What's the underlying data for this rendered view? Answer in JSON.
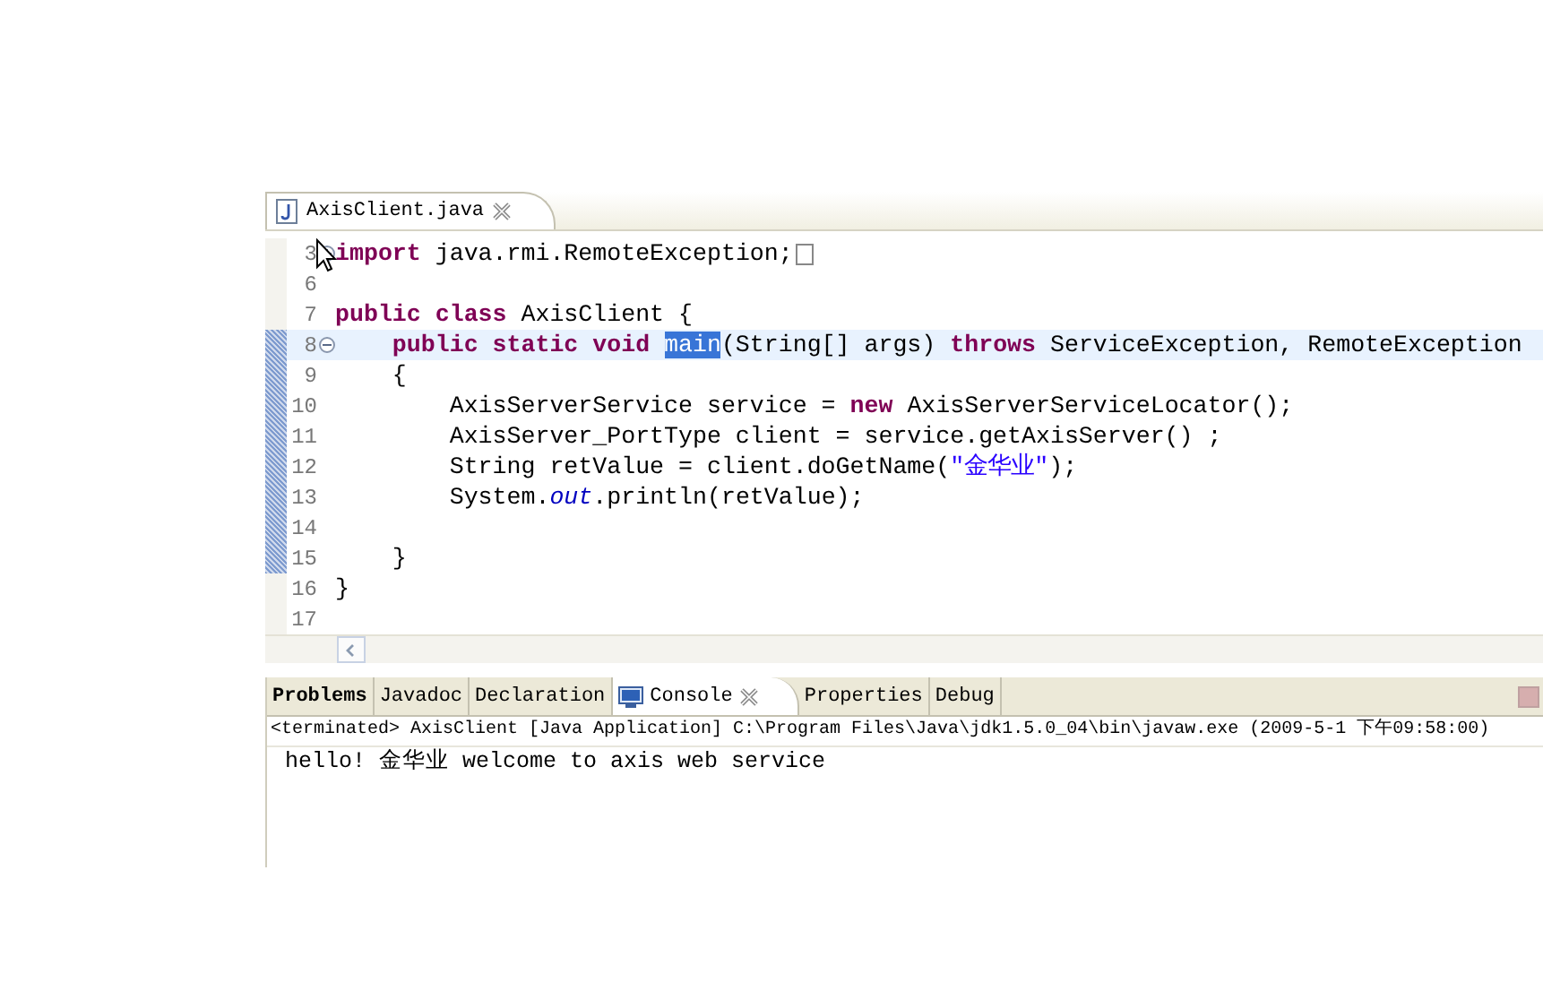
{
  "editor": {
    "tabs": [
      {
        "label": "AxisClient.java",
        "selected": true
      }
    ],
    "lines": [
      {
        "number": "3",
        "expanded": false,
        "marked": false,
        "current": false,
        "tokens": [
          {
            "kind": "keyword",
            "text": "import"
          },
          {
            "kind": "plain",
            "text": " java.rmi.RemoteException;"
          }
        ],
        "folded_box": true
      },
      {
        "number": "6",
        "marked": false,
        "current": false
      },
      {
        "number": "7",
        "marked": false,
        "current": false,
        "tokens": [
          {
            "kind": "keyword",
            "text": "public class "
          },
          {
            "kind": "plain",
            "text": "AxisClient {"
          }
        ]
      },
      {
        "number": "8",
        "expanded": true,
        "marked": true,
        "current": true,
        "tokens": [
          {
            "kind": "keyword",
            "text": "    public static void "
          },
          {
            "kind": "selection",
            "text": "main"
          },
          {
            "kind": "plain",
            "text": "(String[] args) "
          },
          {
            "kind": "keyword",
            "text": "throws"
          },
          {
            "kind": "plain",
            "text": " ServiceException, RemoteException"
          }
        ]
      },
      {
        "number": "9",
        "marked": true,
        "current": false,
        "tokens": [
          {
            "kind": "plain",
            "text": "    {"
          }
        ]
      },
      {
        "number": "10",
        "marked": true,
        "current": false,
        "tokens": [
          {
            "kind": "plain",
            "text": "        AxisServerService service = "
          },
          {
            "kind": "keyword",
            "text": "new"
          },
          {
            "kind": "plain",
            "text": " AxisServerServiceLocator();"
          }
        ]
      },
      {
        "number": "11",
        "marked": true,
        "current": false,
        "tokens": [
          {
            "kind": "plain",
            "text": "        AxisServer_PortType client = service.getAxisServer() ;"
          }
        ]
      },
      {
        "number": "12",
        "marked": true,
        "current": false,
        "tokens": [
          {
            "kind": "plain",
            "text": "        String retValue = client.doGetName("
          },
          {
            "kind": "string",
            "text": "\"金华业\""
          },
          {
            "kind": "plain",
            "text": ");"
          }
        ]
      },
      {
        "number": "13",
        "marked": true,
        "current": false,
        "tokens": [
          {
            "kind": "plain",
            "text": "        System."
          },
          {
            "kind": "field",
            "text": "out"
          },
          {
            "kind": "plain",
            "text": ".println(retValue);"
          }
        ]
      },
      {
        "number": "14",
        "marked": true,
        "current": false
      },
      {
        "number": "15",
        "marked": true,
        "current": false,
        "tokens": [
          {
            "kind": "plain",
            "text": "    }"
          }
        ]
      },
      {
        "number": "16",
        "marked": false,
        "current": false,
        "tokens": [
          {
            "kind": "plain",
            "text": "}"
          }
        ]
      },
      {
        "number": "17",
        "marked": false,
        "current": false
      }
    ]
  },
  "panel": {
    "tabs": [
      {
        "label": "Problems",
        "selected": false,
        "bold": true,
        "icon": false,
        "closable": false
      },
      {
        "label": "Javadoc",
        "selected": false,
        "bold": false,
        "icon": false,
        "closable": false
      },
      {
        "label": "Declaration",
        "selected": false,
        "bold": false,
        "icon": false,
        "closable": false
      },
      {
        "label": "Console",
        "selected": true,
        "bold": false,
        "icon": true,
        "closable": true
      },
      {
        "label": "Properties",
        "selected": false,
        "bold": false,
        "icon": false,
        "closable": false
      },
      {
        "label": "Debug",
        "selected": false,
        "bold": false,
        "icon": false,
        "closable": false
      }
    ],
    "console_header": "<terminated> AxisClient [Java Application] C:\\Program Files\\Java\\jdk1.5.0_04\\bin\\javaw.exe (2009-5-1 下午09:58:00)",
    "output": [
      "hello! 金华业 welcome to axis web service"
    ]
  }
}
